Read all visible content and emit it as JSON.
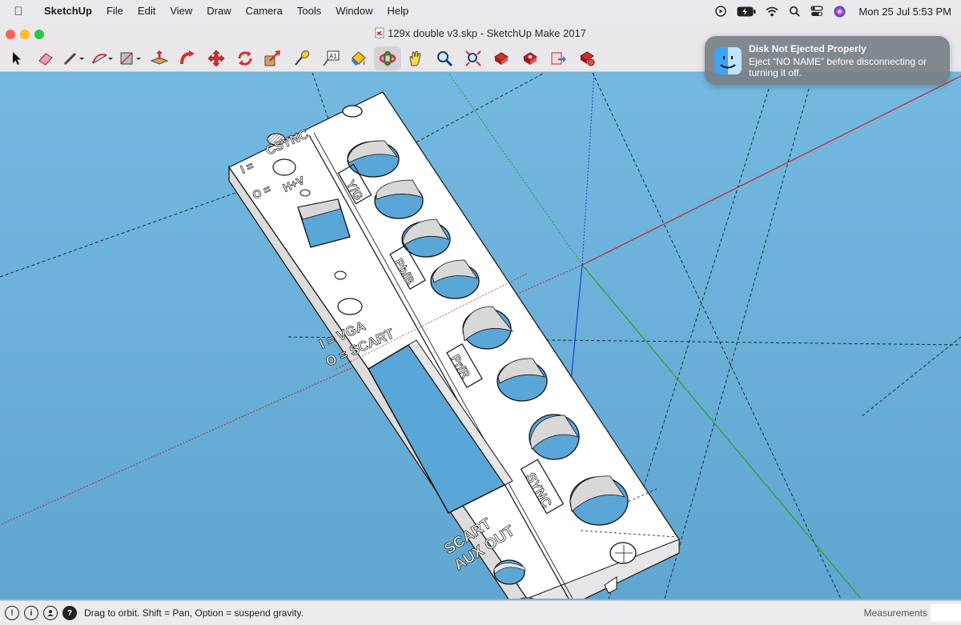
{
  "menubar": {
    "app_name": "SketchUp",
    "menus": [
      "File",
      "Edit",
      "View",
      "Draw",
      "Camera",
      "Tools",
      "Window",
      "Help"
    ],
    "datetime": "Mon 25 Jul  5:53 PM"
  },
  "window": {
    "title": "129x double v3.skp - SketchUp Make 2017"
  },
  "toolbar": {
    "tools": [
      "Select",
      "Eraser",
      "Line",
      "Arc",
      "Shapes",
      "Push/Pull",
      "Follow Me",
      "Move",
      "Rotate",
      "Scale",
      "Tape Measure",
      "Text",
      "Paint Bucket",
      "Orbit",
      "Pan",
      "Zoom",
      "Zoom Extents",
      "3D Warehouse",
      "Extension Warehouse",
      "Send to LayOut",
      "Extension Manager"
    ],
    "active_tool": "Orbit"
  },
  "model": {
    "labels": {
      "csync": "CSYNC",
      "i_equals": "I =",
      "o_equals": "O =",
      "hv": "H+V",
      "vga": "I = VGA",
      "scart": "O = SCART",
      "yg": "Y/G",
      "pbb": "Pb/B",
      "prr": "Pr/R",
      "sync": "SYNC",
      "scart_label": "SCART",
      "aux_out": "AUX OUT"
    }
  },
  "notification": {
    "title": "Disk Not Ejected Properly",
    "body": "Eject “NO NAME” before disconnecting or turning it off."
  },
  "statusbar": {
    "message": "Drag to orbit. Shift = Pan, Option = suspend gravity.",
    "measurements_label": "Measurements",
    "measurements_value": ""
  },
  "colors": {
    "viewport_sky": "#6fb4dc",
    "axis_red": "#c0292b",
    "axis_green": "#2ca02c",
    "axis_blue": "#1a3fd6"
  }
}
